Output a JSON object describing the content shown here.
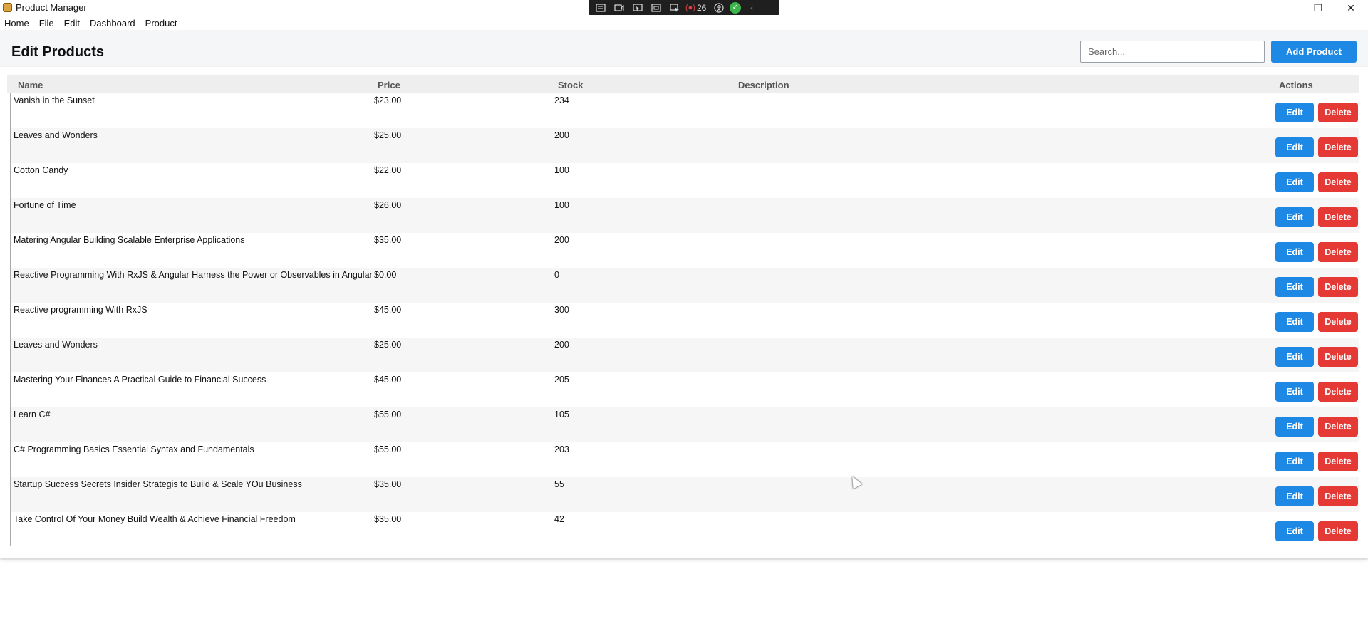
{
  "window": {
    "title": "Product Manager",
    "min_glyph": "—",
    "max_glyph": "❐",
    "close_glyph": "✕"
  },
  "debug_toolbar": {
    "count": "26",
    "icons": [
      "live-tree-icon",
      "record-icon",
      "select-icon",
      "bounds-icon",
      "track-focus-icon",
      "hot-reload-icon",
      "accessibility-icon",
      "ok-icon",
      "collapse-icon"
    ]
  },
  "menu": [
    "Home",
    "File",
    "Edit",
    "Dashboard",
    "Product"
  ],
  "page": {
    "title": "Edit Products",
    "search_placeholder": "Search...",
    "add_label": "Add Product"
  },
  "table": {
    "headers": {
      "name": "Name",
      "price": "Price",
      "stock": "Stock",
      "description": "Description",
      "actions": "Actions"
    },
    "edit_label": "Edit",
    "delete_label": "Delete",
    "rows": [
      {
        "name": "Vanish in the Sunset",
        "price": "$23.00",
        "stock": "234"
      },
      {
        "name": "Leaves and Wonders",
        "price": "$25.00",
        "stock": "200"
      },
      {
        "name": "Cotton Candy",
        "price": "$22.00",
        "stock": "100"
      },
      {
        "name": "Fortune of Time",
        "price": "$26.00",
        "stock": "100"
      },
      {
        "name": "Matering Angular Building Scalable Enterprise Applications",
        "price": "$35.00",
        "stock": "200"
      },
      {
        "name": "Reactive Programming With RxJS & Angular Harness the Power or Observables in Angular",
        "price": "$0.00",
        "stock": "0"
      },
      {
        "name": "Reactive programming With RxJS",
        "price": "$45.00",
        "stock": "300"
      },
      {
        "name": "Leaves and Wonders",
        "price": "$25.00",
        "stock": "200"
      },
      {
        "name": "Mastering Your Finances A Practical Guide to Financial Success",
        "price": "$45.00",
        "stock": "205"
      },
      {
        "name": "Learn C#",
        "price": "$55.00",
        "stock": "105"
      },
      {
        "name": "C# Programming Basics Essential Syntax and Fundamentals",
        "price": "$55.00",
        "stock": "203"
      },
      {
        "name": "Startup Success Secrets Insider Strategis to Build & Scale YOu Business",
        "price": "$35.00",
        "stock": "55"
      },
      {
        "name": "Take Control Of Your Money Build Wealth & Achieve Financial Freedom",
        "price": "$35.00",
        "stock": "42"
      }
    ]
  },
  "colors": {
    "primary": "#1e88e5",
    "danger": "#e53935"
  }
}
